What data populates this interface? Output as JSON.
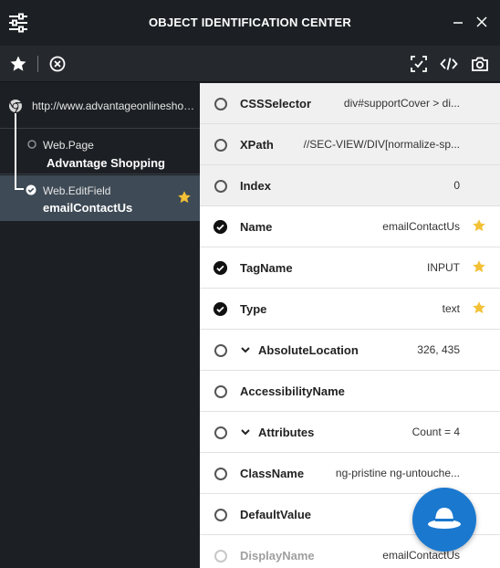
{
  "titlebar": {
    "title": "OBJECT IDENTIFICATION CENTER"
  },
  "tree": {
    "root_url": "http://www.advantageonlineshopping.com",
    "page": {
      "type": "Web.Page",
      "name": "Advantage Shopping"
    },
    "edit": {
      "type": "Web.EditField",
      "name": "emailContactUs"
    }
  },
  "properties": [
    {
      "label": "CSSSelector",
      "value": "div#supportCover > di...",
      "state": "unchecked",
      "starred": false,
      "expandable": false,
      "grey": true
    },
    {
      "label": "XPath",
      "value": "//SEC-VIEW/DIV[normalize-sp...",
      "state": "unchecked",
      "starred": false,
      "expandable": false,
      "grey": true
    },
    {
      "label": "Index",
      "value": "0",
      "state": "unchecked",
      "starred": false,
      "expandable": false,
      "grey": true
    },
    {
      "label": "Name",
      "value": "emailContactUs",
      "state": "checked",
      "starred": true,
      "expandable": false,
      "grey": false
    },
    {
      "label": "TagName",
      "value": "INPUT",
      "state": "checked",
      "starred": true,
      "expandable": false,
      "grey": false
    },
    {
      "label": "Type",
      "value": "text",
      "state": "checked",
      "starred": true,
      "expandable": false,
      "grey": false
    },
    {
      "label": "AbsoluteLocation",
      "value": "326, 435",
      "state": "unchecked",
      "starred": false,
      "expandable": true,
      "grey": false
    },
    {
      "label": "AccessibilityName",
      "value": "",
      "state": "unchecked",
      "starred": false,
      "expandable": false,
      "grey": false
    },
    {
      "label": "Attributes",
      "value": "Count = 4",
      "state": "unchecked",
      "starred": false,
      "expandable": true,
      "grey": false
    },
    {
      "label": "ClassName",
      "value": "ng-pristine ng-untouche...",
      "state": "unchecked",
      "starred": false,
      "expandable": false,
      "grey": false
    },
    {
      "label": "DefaultValue",
      "value": "",
      "state": "unchecked",
      "starred": false,
      "expandable": false,
      "grey": false
    },
    {
      "label": "DisplayName",
      "value": "emailContactUs",
      "state": "disabled",
      "starred": false,
      "expandable": false,
      "grey": false
    }
  ],
  "colors": {
    "accent_blue": "#1a78cf",
    "star_gold": "#f3c135",
    "dark_bg": "#1c2024",
    "selected_row": "#3e4a55"
  },
  "icons": {
    "menu": "sliders-icon",
    "minimize": "minimize-icon",
    "close": "close-icon",
    "favorite": "star-icon",
    "clear": "circle-x-icon",
    "identify": "target-icon",
    "code": "code-icon",
    "snapshot": "camera-icon",
    "browser": "chrome-icon",
    "fab": "hat-icon"
  }
}
